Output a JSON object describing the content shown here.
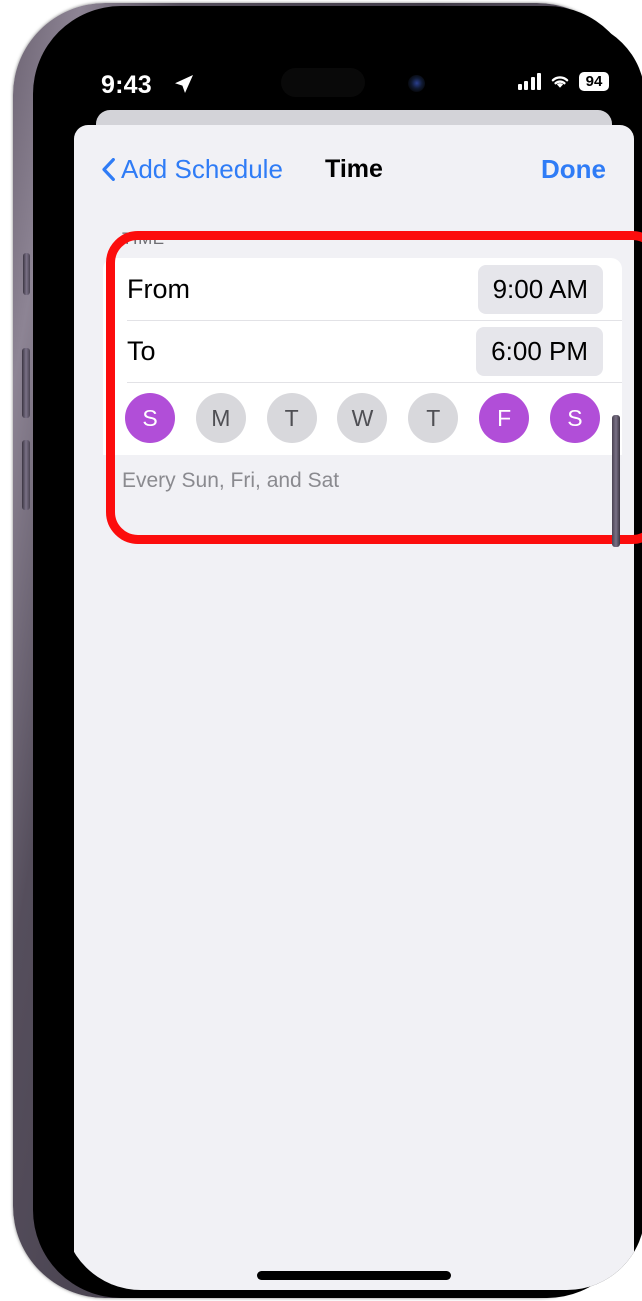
{
  "status_bar": {
    "time": "9:43",
    "location_icon": "location-arrow-icon",
    "signal_icon": "cellular-signal-icon",
    "wifi_icon": "wifi-icon",
    "battery_level": "94"
  },
  "nav_bar": {
    "back_icon": "chevron-left-icon",
    "back_label": "Add Schedule",
    "title": "Time",
    "done_label": "Done"
  },
  "section": {
    "header": "TIME",
    "footer": "Every Sun, Fri, and Sat",
    "rows": [
      {
        "label": "From",
        "value": "9:00 AM"
      },
      {
        "label": "To",
        "value": "6:00 PM"
      }
    ],
    "days": [
      {
        "letter": "S",
        "name": "Sunday",
        "selected": true
      },
      {
        "letter": "M",
        "name": "Monday",
        "selected": false
      },
      {
        "letter": "T",
        "name": "Tuesday",
        "selected": false
      },
      {
        "letter": "W",
        "name": "Wednesday",
        "selected": false
      },
      {
        "letter": "T",
        "name": "Thursday",
        "selected": false
      },
      {
        "letter": "F",
        "name": "Friday",
        "selected": true
      },
      {
        "letter": "S",
        "name": "Saturday",
        "selected": true
      }
    ]
  },
  "colors": {
    "accent_blue": "#2f7cf6",
    "day_selected": "#b14ed8",
    "day_unselected": "#d8d8dc",
    "annotation_red": "#fc0d0d",
    "sheet_background": "#f1f1f5"
  }
}
